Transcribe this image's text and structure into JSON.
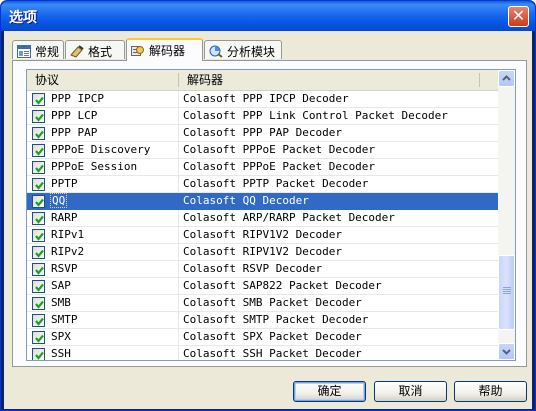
{
  "window": {
    "title": "选项",
    "close_glyph": "✕"
  },
  "tabs": [
    {
      "label": "常规",
      "icon": "general-icon"
    },
    {
      "label": "格式",
      "icon": "format-icon"
    },
    {
      "label": "解码器",
      "icon": "decoder-icon",
      "active": true
    },
    {
      "label": "分析模块",
      "icon": "analysis-module-icon"
    }
  ],
  "list": {
    "columns": [
      "协议",
      "解码器"
    ],
    "rows": [
      {
        "protocol": "PPP IPCP",
        "decoder": "Colasoft PPP IPCP Decoder",
        "checked": true
      },
      {
        "protocol": "PPP LCP",
        "decoder": "Colasoft PPP Link Control Packet Decoder",
        "checked": true
      },
      {
        "protocol": "PPP PAP",
        "decoder": "Colasoft PPP PAP Decoder",
        "checked": true
      },
      {
        "protocol": "PPPoE Discovery",
        "decoder": "Colasoft PPPoE Packet Decoder",
        "checked": true
      },
      {
        "protocol": "PPPoE Session",
        "decoder": "Colasoft PPPoE Packet Decoder",
        "checked": true
      },
      {
        "protocol": "PPTP",
        "decoder": "Colasoft PPTP Packet Decoder",
        "checked": true
      },
      {
        "protocol": "QQ",
        "decoder": "Colasoft QQ Decoder",
        "checked": true,
        "selected": true
      },
      {
        "protocol": "RARP",
        "decoder": "Colasoft ARP/RARP Packet Decoder",
        "checked": true
      },
      {
        "protocol": "RIPv1",
        "decoder": "Colasoft RIPV1V2 Decoder",
        "checked": true
      },
      {
        "protocol": "RIPv2",
        "decoder": "Colasoft RIPV1V2 Decoder",
        "checked": true
      },
      {
        "protocol": "RSVP",
        "decoder": "Colasoft RSVP Decoder",
        "checked": true
      },
      {
        "protocol": "SAP",
        "decoder": "Colasoft SAP822 Packet Decoder",
        "checked": true
      },
      {
        "protocol": "SMB",
        "decoder": "Colasoft SMB Packet Decoder",
        "checked": true
      },
      {
        "protocol": "SMTP",
        "decoder": "Colasoft SMTP Packet Decoder",
        "checked": true
      },
      {
        "protocol": "SPX",
        "decoder": "Colasoft SPX Packet Decoder",
        "checked": true
      },
      {
        "protocol": "SSH",
        "decoder": "Colasoft SSH Packet Decoder",
        "checked": true
      }
    ]
  },
  "buttons": {
    "ok": "确定",
    "cancel": "取消",
    "help": "帮助"
  },
  "colors": {
    "selection": "#316ac5",
    "checkmark": "#21a121",
    "titlebar": "#0858e4"
  }
}
